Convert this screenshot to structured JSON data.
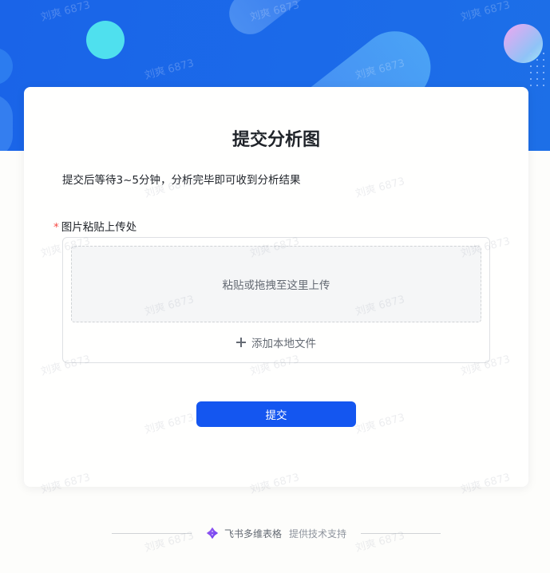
{
  "form": {
    "title": "提交分析图",
    "description": "提交后等待3~5分钟，分析完毕即可收到分析结果",
    "field": {
      "required_mark": "*",
      "label": "图片粘贴上传处",
      "paste_hint": "粘贴或拖拽至这里上传",
      "add_local_label": "添加本地文件"
    },
    "submit_label": "提交"
  },
  "footer": {
    "brand": "飞书多维表格",
    "support": "提供技术支持"
  },
  "watermark": {
    "text": "刘爽 6873"
  },
  "colors": {
    "banner": "#1a64e8",
    "primary_button": "#1456f0",
    "required": "#f54a45"
  }
}
